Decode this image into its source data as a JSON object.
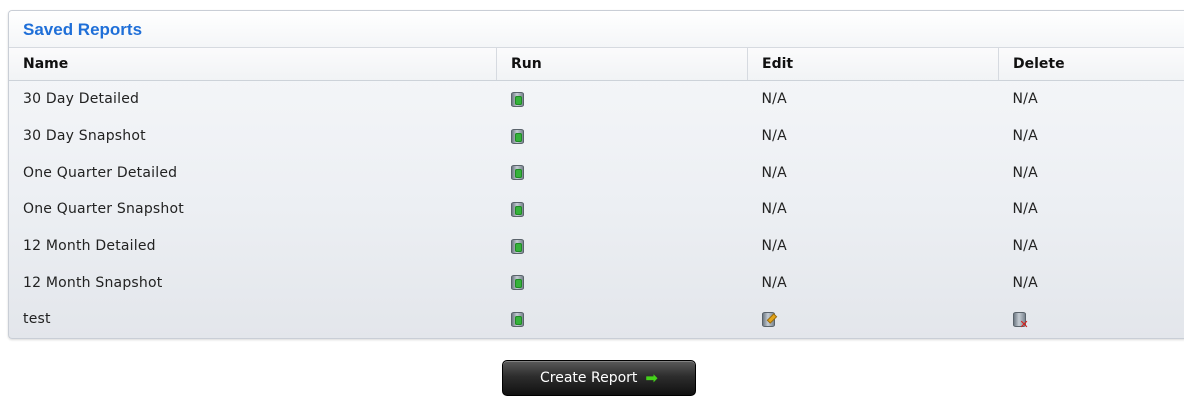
{
  "panel": {
    "title": "Saved Reports"
  },
  "table": {
    "headers": {
      "name": "Name",
      "run": "Run",
      "edit": "Edit",
      "delete": "Delete"
    },
    "rows": [
      {
        "name": "30 Day Detailed",
        "run_icon": "database-run-icon",
        "edit": "N/A",
        "delete": "N/A"
      },
      {
        "name": "30 Day Snapshot",
        "run_icon": "database-run-icon",
        "edit": "N/A",
        "delete": "N/A"
      },
      {
        "name": "One Quarter Detailed",
        "run_icon": "database-run-icon",
        "edit": "N/A",
        "delete": "N/A"
      },
      {
        "name": "One Quarter Snapshot",
        "run_icon": "database-run-icon",
        "edit": "N/A",
        "delete": "N/A"
      },
      {
        "name": "12 Month Detailed",
        "run_icon": "database-run-icon",
        "edit": "N/A",
        "delete": "N/A"
      },
      {
        "name": "12 Month Snapshot",
        "run_icon": "database-run-icon",
        "edit": "N/A",
        "delete": "N/A"
      },
      {
        "name": "test",
        "run_icon": "database-run-icon",
        "edit_icon": "database-edit-icon",
        "delete_icon": "database-delete-icon"
      }
    ]
  },
  "create_button": {
    "label": "Create Report",
    "icon": "green-arrow-right-icon"
  },
  "colors": {
    "title": "#1f6fd8",
    "run": "#35b23a",
    "edit": "#e3a41a",
    "delete": "#d8201b"
  }
}
